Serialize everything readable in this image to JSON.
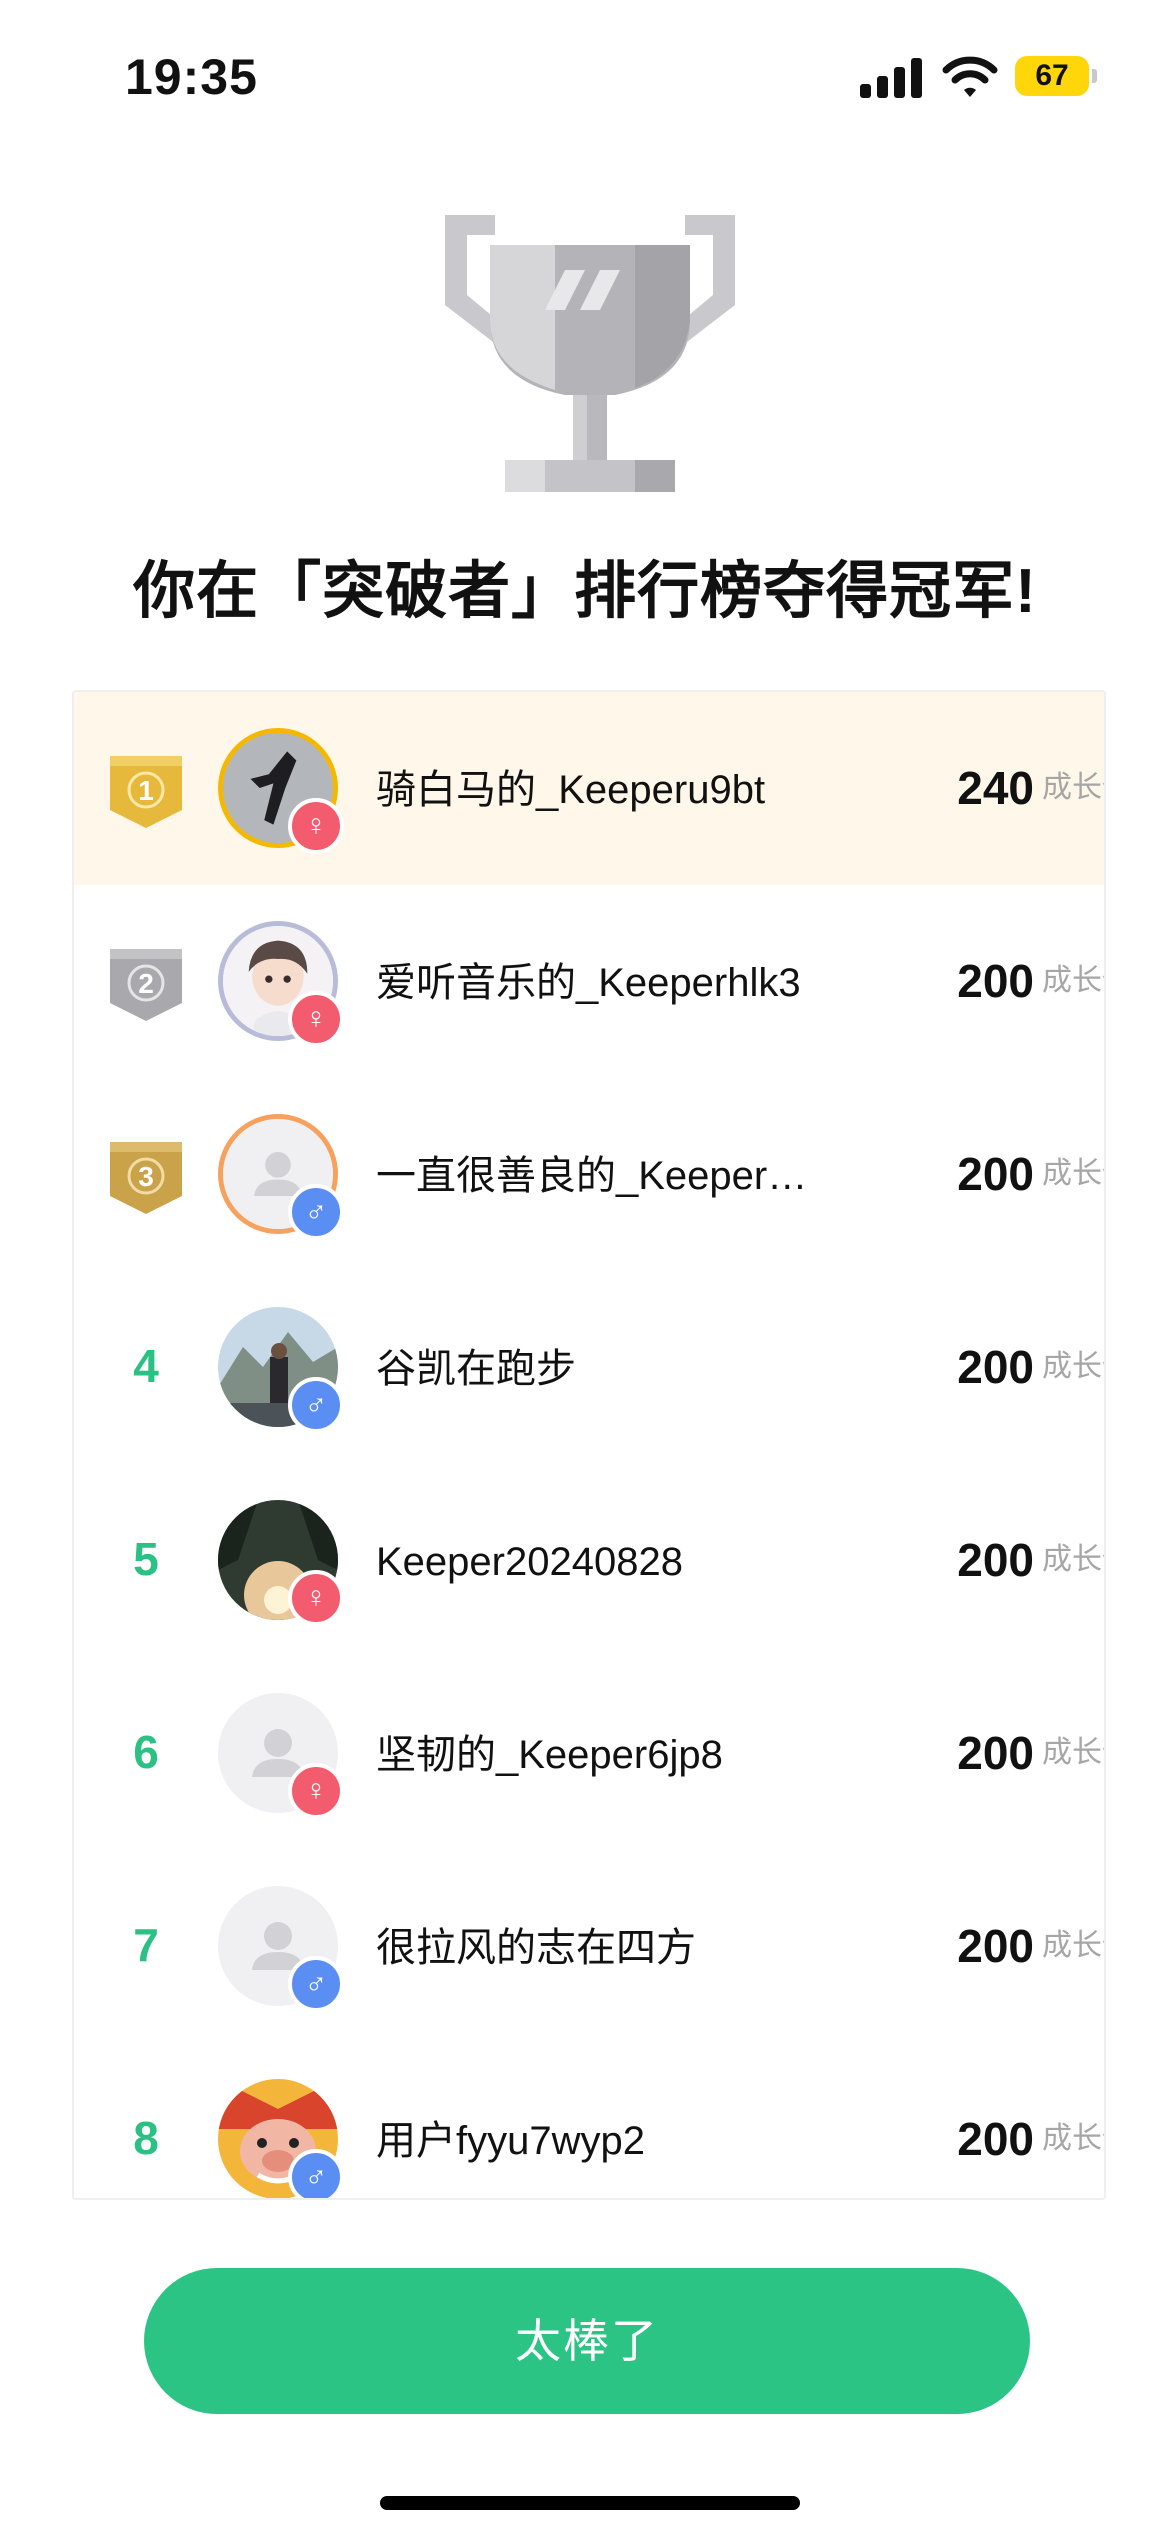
{
  "status_bar": {
    "time": "19:35",
    "battery": "67"
  },
  "headline": "你在「突破者」排行榜夺得冠军!",
  "ranking": [
    {
      "rank": "1",
      "name": "骑白马的_Keeperu9bt",
      "score": "240",
      "unit": "成长值",
      "gender": "♀"
    },
    {
      "rank": "2",
      "name": "爱听音乐的_Keeperhlk3",
      "score": "200",
      "unit": "成长值",
      "gender": "♀"
    },
    {
      "rank": "3",
      "name": "一直很善良的_Keeper…",
      "score": "200",
      "unit": "成长值",
      "gender": "♂"
    },
    {
      "rank": "4",
      "name": "谷凯在跑步",
      "score": "200",
      "unit": "成长值",
      "gender": "♂"
    },
    {
      "rank": "5",
      "name": "Keeper20240828",
      "score": "200",
      "unit": "成长值",
      "gender": "♀"
    },
    {
      "rank": "6",
      "name": "坚韧的_Keeper6jp8",
      "score": "200",
      "unit": "成长值",
      "gender": "♀"
    },
    {
      "rank": "7",
      "name": "很拉风的志在四方",
      "score": "200",
      "unit": "成长值",
      "gender": "♂"
    },
    {
      "rank": "8",
      "name": "用户fyyu7wyp2",
      "score": "200",
      "unit": "成长值",
      "gender": "♂"
    }
  ],
  "cta_label": "太棒了",
  "colors": {
    "accent": "#2bc485",
    "first_row_bg": "#fff8ea",
    "female": "#f25c6e",
    "male": "#5b8ef2",
    "gold": "#e6b93c",
    "silver": "#a9a9ad",
    "bronze": "#c9a24a"
  },
  "icons": {
    "trophy": "silver-trophy-icon",
    "signal": "cellular-signal-icon",
    "wifi": "wifi-icon",
    "battery": "battery-icon"
  }
}
